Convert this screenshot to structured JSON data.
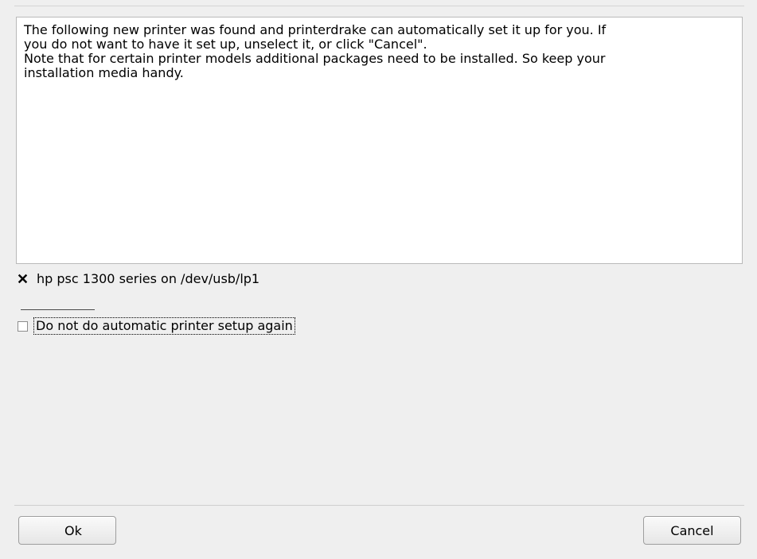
{
  "dialog": {
    "message_lines": [
      "The following new printer was found and printerdrake can automatically set it up for you. If",
      "you do not want to have it set up, unselect it, or click \"Cancel\".",
      "Note that for certain printer models additional packages need to be installed. So keep your",
      "installation media handy."
    ],
    "printer_option": {
      "label": "hp psc 1300 series on /dev/usb/lp1",
      "checked": true
    },
    "no_auto_option": {
      "label": "Do not do automatic printer setup again",
      "checked": false
    },
    "buttons": {
      "ok": "Ok",
      "cancel": "Cancel"
    }
  }
}
